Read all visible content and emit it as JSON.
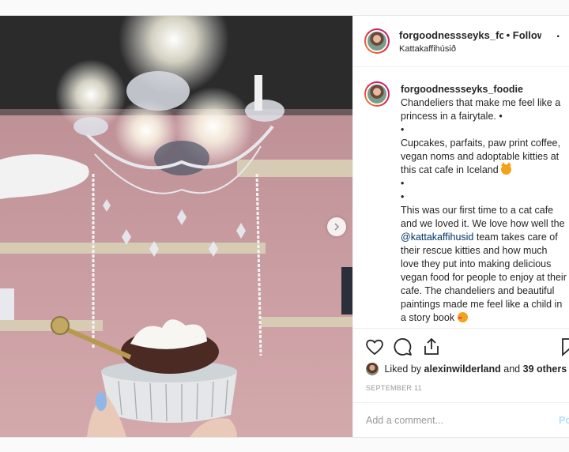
{
  "post": {
    "username": "forgoodnessseyks_foodie",
    "follow_status": "Following",
    "location": "Kattakaffihúsið",
    "more_icon": "ellipsis-icon"
  },
  "caption": {
    "username": "forgoodnessseyks_foodie",
    "line1": "Chandeliers that make me feel like a princess in a fairytale. •",
    "bullet": "•",
    "line2": "Cupcakes, parfaits, paw print coffee, vegan noms and adoptable kitties at this cat cafe in Iceland",
    "line3a": "This was our first time to a cat cafe and we loved it. We love how well the",
    "mention": "@kattakaffihusid",
    "line3b": "team takes care of their rescue kitties and how much love they put into making delicious vegan food for people to enjoy at their cafe. The chandeliers and beautiful paintings made me feel like a child in a story book"
  },
  "likes": {
    "prefix": "Liked by",
    "user": "alexinwilderland",
    "conj": "and",
    "others": "39 others"
  },
  "date": "SEPTEMBER 11",
  "comment_box": {
    "placeholder": "Add a comment...",
    "post_label": "Po"
  },
  "icons": [
    "heart-icon",
    "comment-icon",
    "share-icon",
    "bookmark-icon",
    "chevron-right-icon"
  ]
}
